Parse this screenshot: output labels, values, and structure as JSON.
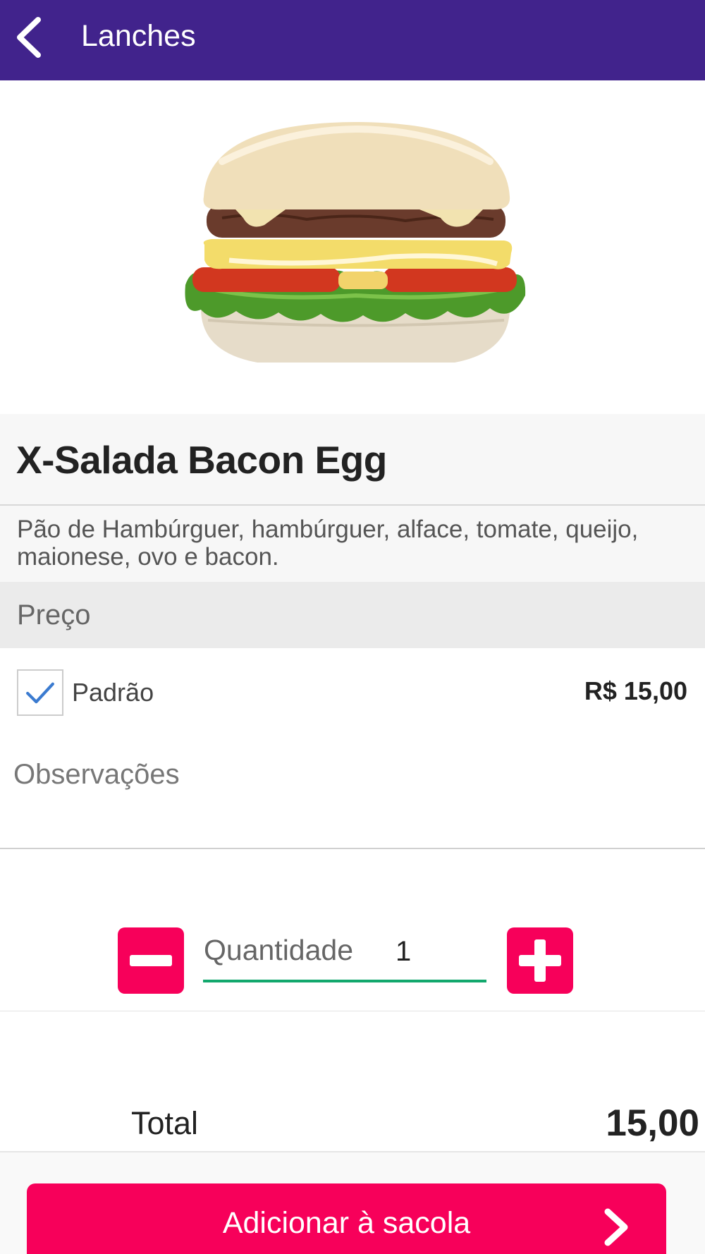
{
  "appbar": {
    "title": "Lanches",
    "back_icon": "chevron-left-icon"
  },
  "product": {
    "name": "X-Salada Bacon Egg",
    "description": "Pão de Hambúrguer, hambúrguer, alface, tomate, queijo, maionese, ovo e bacon."
  },
  "price_section": {
    "header": "Preço",
    "option": {
      "label": "Padrão",
      "price": "R$ 15,00",
      "checked": true
    }
  },
  "notes": {
    "placeholder": "Observações"
  },
  "quantity": {
    "label": "Quantidade",
    "value": "1"
  },
  "total": {
    "label": "Total",
    "value": "15,00"
  },
  "cta": {
    "label": "Adicionar à sacola",
    "icon": "chevron-right-icon"
  },
  "colors": {
    "appbar": "#41238c",
    "accent": "#f7005a",
    "qty_underline": "#12a86d",
    "check": "#3b7bd0"
  }
}
